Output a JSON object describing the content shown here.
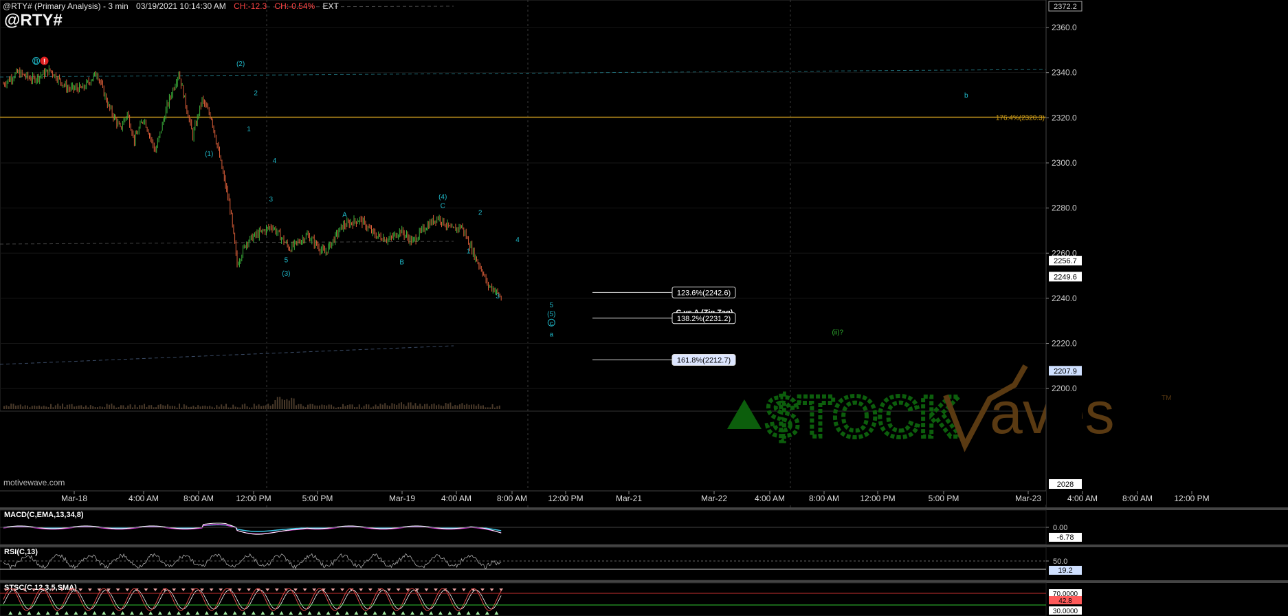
{
  "header": {
    "title": "@RTY# (Primary Analysis) - 3 min",
    "datetime": "03/19/2021 10:14:30 AM",
    "change": "CH:-12.3",
    "change_pct": "CH:-0.54%",
    "session": "EXT",
    "symbol": "@RTY#",
    "brand": "motivewave.com"
  },
  "colors": {
    "background": "#000000",
    "bull": "#3bb33b",
    "bear": "#e0603a",
    "wave_label": "#1fb8c8",
    "fib_line": "#d4a017",
    "grid": "#2d3a3a",
    "macd": "#ffffff",
    "macd_signal": "#e040e0",
    "stoch_k": "#e04848",
    "stoch_d": "#ffffff",
    "overbought_line": "#c83030",
    "oversold_line": "#30c830",
    "watermark_stock": "#0c5e0c",
    "watermark_waves": "#5a3a12"
  },
  "chart_data": {
    "type": "line",
    "title": "@RTY#",
    "y_axis_ticks": [
      "2360.0",
      "2340.0",
      "2320.0",
      "2300.0",
      "2280.0",
      "2260.0",
      "2240.0",
      "2220.0",
      "2200.0"
    ],
    "ylim": [
      2190,
      2372.2
    ],
    "y_top_label": "2372.2",
    "y_bottom_label": "2028",
    "x_tick_labels": [
      "Mar-18",
      "4:00 AM",
      "8:00 AM",
      "12:00 PM",
      "5:00 PM",
      "Mar-19",
      "4:00 AM",
      "8:00 AM",
      "12:00 PM",
      "Mar-21",
      "Mar-22",
      "4:00 AM",
      "8:00 AM",
      "12:00 PM",
      "5:00 PM",
      "Mar-23",
      "4:00 AM",
      "8:00 AM",
      "12:00 PM"
    ],
    "price_path": {
      "x_bars": [
        0,
        12,
        25,
        40,
        55,
        68,
        80,
        90,
        100,
        106,
        112,
        120,
        130,
        140,
        150,
        162,
        170,
        178,
        186,
        194,
        200,
        208,
        216,
        230,
        245,
        260,
        275,
        290,
        305,
        318,
        330,
        340,
        350,
        362,
        372,
        384,
        392,
        398,
        404,
        410,
        414,
        420,
        426
      ],
      "prices": [
        2335,
        2340,
        2337,
        2341,
        2333,
        2333,
        2340,
        2325,
        2315,
        2322,
        2310,
        2320,
        2305,
        2325,
        2340,
        2312,
        2328,
        2320,
        2300,
        2280,
        2255,
        2265,
        2268,
        2272,
        2262,
        2268,
        2260,
        2272,
        2275,
        2268,
        2266,
        2270,
        2265,
        2272,
        2276,
        2270,
        2272,
        2265,
        2258,
        2252,
        2246,
        2244,
        2240
      ]
    },
    "annotations": [
      {
        "text": "(1)",
        "x_bar": 176,
        "price": 2303
      },
      {
        "text": "(2)",
        "x_bar": 203,
        "price": 2343
      },
      {
        "text": "2",
        "x_bar": 216,
        "price": 2330
      },
      {
        "text": "1",
        "x_bar": 210,
        "price": 2314
      },
      {
        "text": "4",
        "x_bar": 232,
        "price": 2300
      },
      {
        "text": "3",
        "x_bar": 229,
        "price": 2283
      },
      {
        "text": "5",
        "x_bar": 242,
        "price": 2256
      },
      {
        "text": "(3)",
        "x_bar": 242,
        "price": 2250
      },
      {
        "text": "A",
        "x_bar": 292,
        "price": 2276
      },
      {
        "text": "B",
        "x_bar": 341,
        "price": 2255
      },
      {
        "text": "(4)",
        "x_bar": 376,
        "price": 2284
      },
      {
        "text": "C",
        "x_bar": 376,
        "price": 2280
      },
      {
        "text": "2",
        "x_bar": 408,
        "price": 2277
      },
      {
        "text": "1",
        "x_bar": 398,
        "price": 2260
      },
      {
        "text": "4",
        "x_bar": 440,
        "price": 2265
      },
      {
        "text": "3",
        "x_bar": 423,
        "price": 2240
      },
      {
        "text": "5",
        "x_bar": 469,
        "price": 2236
      },
      {
        "text": "(5)",
        "x_bar": 469,
        "price": 2232
      },
      {
        "text": "c",
        "x_bar": 469,
        "price": 2228
      },
      {
        "text": "a",
        "x_bar": 469,
        "price": 2223
      },
      {
        "text": "b",
        "x_bar": 824,
        "price": 2329
      },
      {
        "text": "(ii)?",
        "x_bar": 714,
        "price": 2224
      },
      {
        "text": "B",
        "x_bar": 28,
        "price": 2344
      },
      {
        "text": "!",
        "x_bar": 35,
        "price": 2344
      }
    ],
    "fib_level": {
      "label": "176.4%(2320.3)",
      "price": 2320.3
    },
    "fib_box": {
      "title": "C vs A (Zig Zag)",
      "levels": [
        {
          "label": "123.6%(2242.6)",
          "price": 2242.6
        },
        {
          "label": "138.2%(2231.2)",
          "price": 2231.2
        },
        {
          "label": "161.8%(2212.7)",
          "price": 2212.7
        }
      ]
    },
    "price_markers": [
      {
        "label": "2256.7",
        "price": 2256.7
      },
      {
        "label": "2249.6",
        "price": 2249.6
      },
      {
        "label": "2207.9",
        "price": 2207.9
      }
    ],
    "watermark": {
      "stock": "$TOCK",
      "waves": "Waves",
      "tm": "TM"
    },
    "panels": [
      {
        "name": "MACD(C,EMA,13,34,8)",
        "ticks": [
          "0.00"
        ],
        "marker": "-6.78"
      },
      {
        "name": "RSI(C,13)",
        "ticks": [
          "50.0"
        ],
        "marker": "19.2"
      },
      {
        "name": "STSC(C,12,3,5,SMA)",
        "ticks": [
          "70.0000",
          "30.0000"
        ],
        "marker": "42.8"
      }
    ]
  }
}
